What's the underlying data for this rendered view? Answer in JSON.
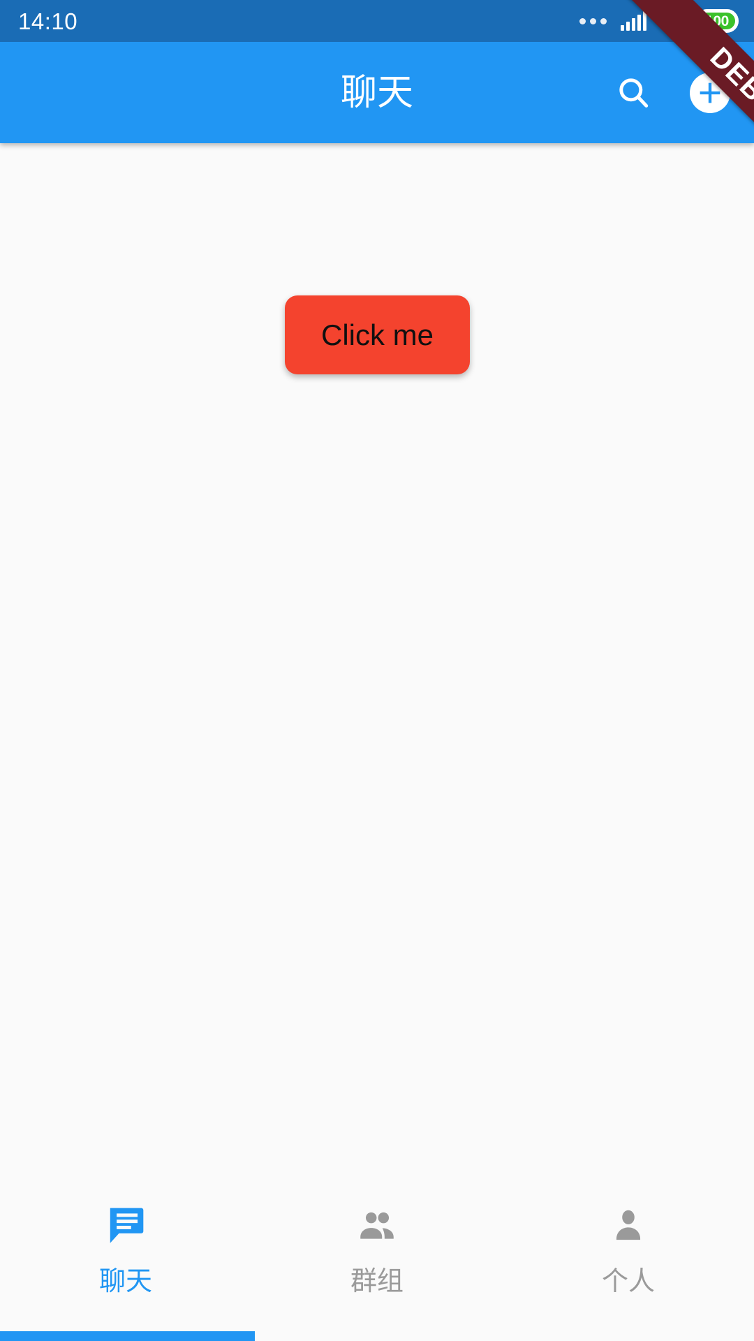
{
  "status_bar": {
    "time": "14:10",
    "icons": {
      "overflow_dots": "more-dots-icon",
      "signal": "cellular-signal-icon",
      "wifi": "wifi-icon",
      "battery": "battery-icon"
    },
    "battery_level": "100",
    "background_color": "#1A6CB5"
  },
  "debug_banner": {
    "label": "DEBUG",
    "color": "#6A1B25"
  },
  "app_bar": {
    "title": "聊天",
    "background_color": "#2196F3",
    "search_icon": "search-icon",
    "add_icon": "plus-icon"
  },
  "main": {
    "button_label": "Click me",
    "button_color": "#F4432E",
    "background_color": "#FAFAFA"
  },
  "bottom_nav": {
    "items": [
      {
        "label": "聊天",
        "icon": "chat-bubble-icon",
        "active": true,
        "color": "#2196F3"
      },
      {
        "label": "群组",
        "icon": "people-icon",
        "active": false,
        "color": "#9A9A9A"
      },
      {
        "label": "个人",
        "icon": "person-icon",
        "active": false,
        "color": "#9A9A9A"
      }
    ]
  },
  "bottom_progress": {
    "percent": "33.8",
    "color": "#2196F3"
  }
}
